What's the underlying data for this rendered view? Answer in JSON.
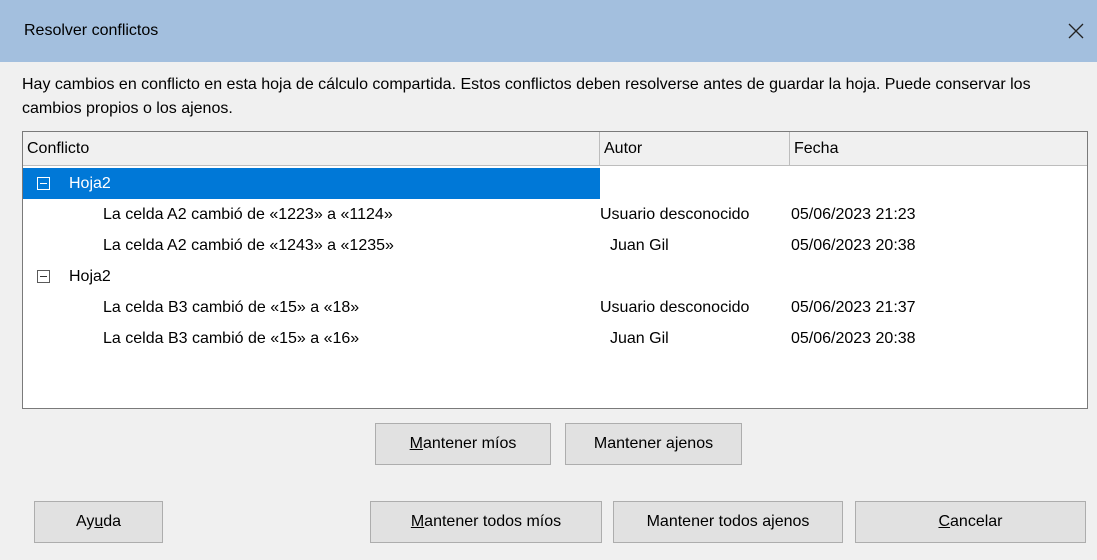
{
  "dialog": {
    "title": "Resolver conflictos",
    "description": "Hay cambios en conflicto en esta hoja de cálculo compartida. Estos conflictos deben resolverse antes de guardar la hoja. Puede conservar los cambios propios o los ajenos."
  },
  "table": {
    "columns": [
      "Conflicto",
      "Autor",
      "Fecha"
    ],
    "groups": [
      {
        "label": "Hoja2",
        "selected": true,
        "rows": [
          {
            "conflict": "La celda A2 cambió de «1223» a «1124»",
            "author": "Usuario desconocido",
            "date": "05/06/2023 21:23"
          },
          {
            "conflict": "La celda A2 cambió de «1243» a «1235»",
            "author": "Juan Gil",
            "date": "05/06/2023 20:38"
          }
        ]
      },
      {
        "label": "Hoja2",
        "selected": false,
        "rows": [
          {
            "conflict": "La celda B3 cambió de «15» a «18»",
            "author": "Usuario desconocido",
            "date": "05/06/2023 21:37"
          },
          {
            "conflict": "La celda B3 cambió de «15» a «16»",
            "author": "Juan Gil",
            "date": "05/06/2023 20:38"
          }
        ]
      }
    ]
  },
  "buttons": {
    "keep_mine": {
      "before": "",
      "mnemonic": "M",
      "after": "antener míos"
    },
    "keep_others": {
      "before": "Mantener a",
      "mnemonic": "j",
      "after": "enos"
    },
    "help": {
      "before": "Ay",
      "mnemonic": "u",
      "after": "da"
    },
    "keep_all_mine": {
      "before": "",
      "mnemonic": "M",
      "after": "antener todos míos"
    },
    "keep_all_others": {
      "before": "Mantener todos a",
      "mnemonic": "j",
      "after": "enos"
    },
    "cancel": {
      "before": "",
      "mnemonic": "C",
      "after": "ancelar"
    }
  }
}
